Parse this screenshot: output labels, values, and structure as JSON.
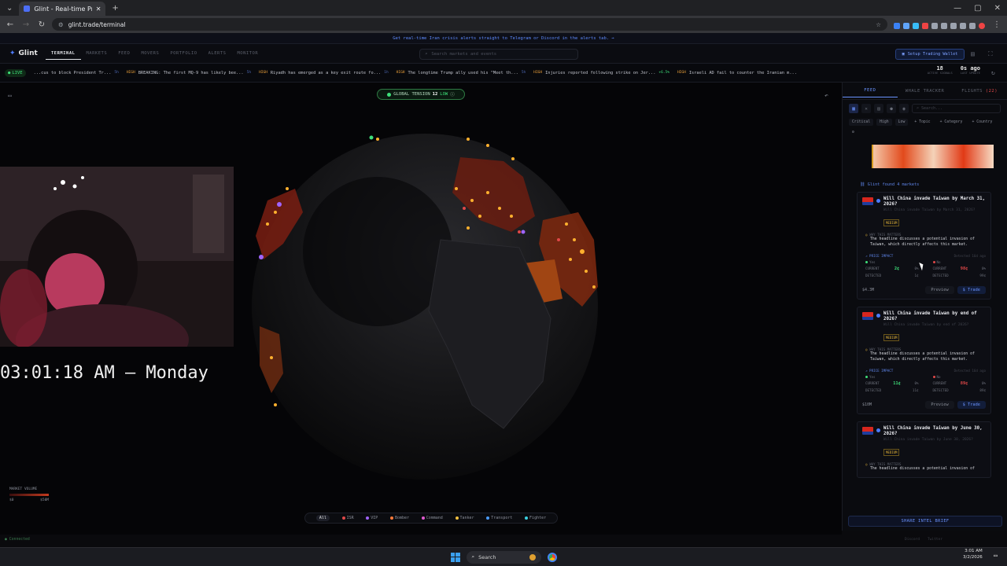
{
  "browser": {
    "tab_title": "Glint - Real-time Prediction Ma",
    "url": "glint.trade/terminal"
  },
  "banner": {
    "text": "Get real-time Iran crisis alerts straight to Telegram or Discord in the alerts tab. →"
  },
  "nav": {
    "logo": "Glint",
    "tabs": [
      "TERMINAL",
      "MARKETS",
      "FEED",
      "MOVERS",
      "PORTFOLIO",
      "ALERTS",
      "MONITOR"
    ],
    "search_placeholder": "Search markets and events",
    "wallet_button": "Setup Trading Wallet"
  },
  "ticker": {
    "live": "LIVE",
    "items": [
      {
        "text": "...cus to block President Tr...",
        "meta": "5h"
      },
      {
        "tag": "HIGH",
        "text": "BREAKING: The first MQ-9 has likely bee...",
        "meta": "5h"
      },
      {
        "tag": "HIGH",
        "text": "Riyadh has emerged as a key exit route fo...",
        "meta": "1h"
      },
      {
        "tag": "HIGH",
        "text": "The longtime Trump ally used his \"Meet th...",
        "meta": "5h"
      },
      {
        "tag": "HIGH",
        "text": "Injuries reported following strike on Jer...",
        "meta": "+6.5%"
      },
      {
        "tag": "HIGH",
        "text": "Israeli AD fail to counter the Iranian m...",
        "meta": ""
      }
    ],
    "active_signals_value": "18",
    "active_signals_label": "ACTIVE SIGNALS",
    "last_update_value": "0s ago",
    "last_update_label": "LAST UPDATE"
  },
  "map": {
    "tension_label": "GLOBAL TENSION",
    "tension_value": "12",
    "tension_level": "LOW",
    "clock": "03:01:18 AM — Monday",
    "legend_title": "MARKET VOLUME",
    "legend_min": "$0",
    "legend_max": "$50M",
    "filters": [
      "All",
      "ISR",
      "VIP",
      "Bomber",
      "Command",
      "Tanker",
      "Transport",
      "Fighter"
    ],
    "filter_colors": [
      "",
      "#e04848",
      "#a064ff",
      "#ff7a3a",
      "#e05ad0",
      "#f0c040",
      "#4a9cff",
      "#3ad0e0"
    ],
    "status": "Connected"
  },
  "panel": {
    "tabs": [
      "FEED",
      "WHALE TRACKER",
      "FLIGHTS"
    ],
    "flights_badge": "(22)",
    "search_placeholder": "Search...",
    "filter_chips": [
      "Critical",
      "High",
      "Low",
      "+ Topic",
      "+ Category",
      "+ Country"
    ],
    "found_text": "Glint found 4 markets",
    "cards": [
      {
        "question": "Will China invade Taiwan by March 31, 2026?",
        "sub": "Will China invade Taiwan by March 31, 2026?",
        "risk": "MEDIUM",
        "why_label": "WHY THIS MATTERS",
        "why": "The headline discusses a potential invasion of Taiwan, which directly affects this market.",
        "impact_label": "PRICE IMPACT",
        "detected": "Detected 16d ago",
        "yes_label": "Yes",
        "no_label": "No",
        "current_label": "CURRENT",
        "detected_label": "DETECTED",
        "yes_current": "2¢",
        "yes_pct": "0%",
        "yes_detected": "1¢",
        "no_current": "98¢",
        "no_pct": "0%",
        "no_detected": "99¢",
        "volume": "$4.3M",
        "preview": "Preview",
        "trade": "$ Trade"
      },
      {
        "question": "Will China invade Taiwan by end of 2026?",
        "sub": "Will China invade Taiwan by end of 2026?",
        "risk": "MEDIUM",
        "why_label": "WHY THIS MATTERS",
        "why": "The headline discusses a potential invasion of Taiwan, which directly affects this market.",
        "impact_label": "PRICE IMPACT",
        "detected": "Detected 16d ago",
        "yes_label": "Yes",
        "no_label": "No",
        "current_label": "CURRENT",
        "detected_label": "DETECTED",
        "yes_current": "11¢",
        "yes_pct": "0%",
        "yes_detected": "11¢",
        "no_current": "89¢",
        "no_pct": "0%",
        "no_detected": "89¢",
        "volume": "$10M",
        "preview": "Preview",
        "trade": "$ Trade"
      },
      {
        "question": "Will China invade Taiwan by June 30, 2026?",
        "sub": "Will China invade Taiwan by June 30, 2026?",
        "risk": "MEDIUM",
        "why_label": "WHY THIS MATTERS",
        "why": "The headline discusses a potential invasion of",
        "impact_label": "",
        "detected": "",
        "yes_label": "",
        "no_label": "",
        "current_label": "",
        "detected_label": "",
        "yes_current": "",
        "yes_pct": "",
        "yes_detected": "",
        "no_current": "",
        "no_pct": "",
        "no_detected": "",
        "volume": "",
        "preview": "",
        "trade": ""
      }
    ],
    "share_button": "SHARE INTEL BRIEF",
    "footer": [
      "Discord",
      "Twitter"
    ]
  },
  "taskbar": {
    "search": "Search",
    "time": "3:01 AM",
    "date": "3/2/2026"
  }
}
